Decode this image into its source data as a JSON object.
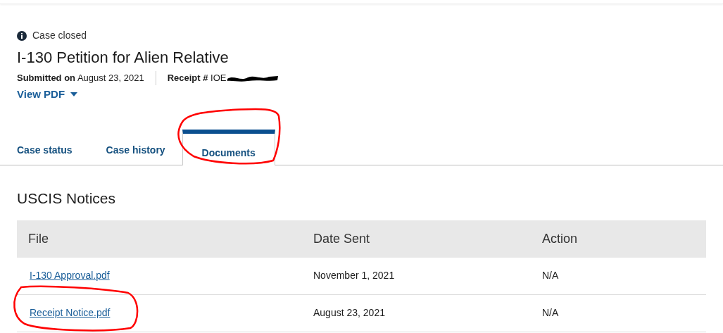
{
  "status": {
    "label": "Case closed"
  },
  "title": "I-130 Petition for Alien Relative",
  "meta": {
    "submitted_label": "Submitted on",
    "submitted_date": "August 23, 2021",
    "receipt_label": "Receipt #",
    "receipt_value": "IOE"
  },
  "view_pdf": "View PDF",
  "tabs": [
    {
      "label": "Case status",
      "selected": false
    },
    {
      "label": "Case history",
      "selected": false
    },
    {
      "label": "Documents",
      "selected": true
    }
  ],
  "section_title": "USCIS Notices",
  "table": {
    "columns": [
      "File",
      "Date Sent",
      "Action"
    ],
    "rows": [
      {
        "file": "I-130 Approval.pdf",
        "date": "November 1, 2021",
        "action": "N/A"
      },
      {
        "file": "Receipt Notice.pdf",
        "date": "August 23, 2021",
        "action": "N/A"
      }
    ]
  }
}
